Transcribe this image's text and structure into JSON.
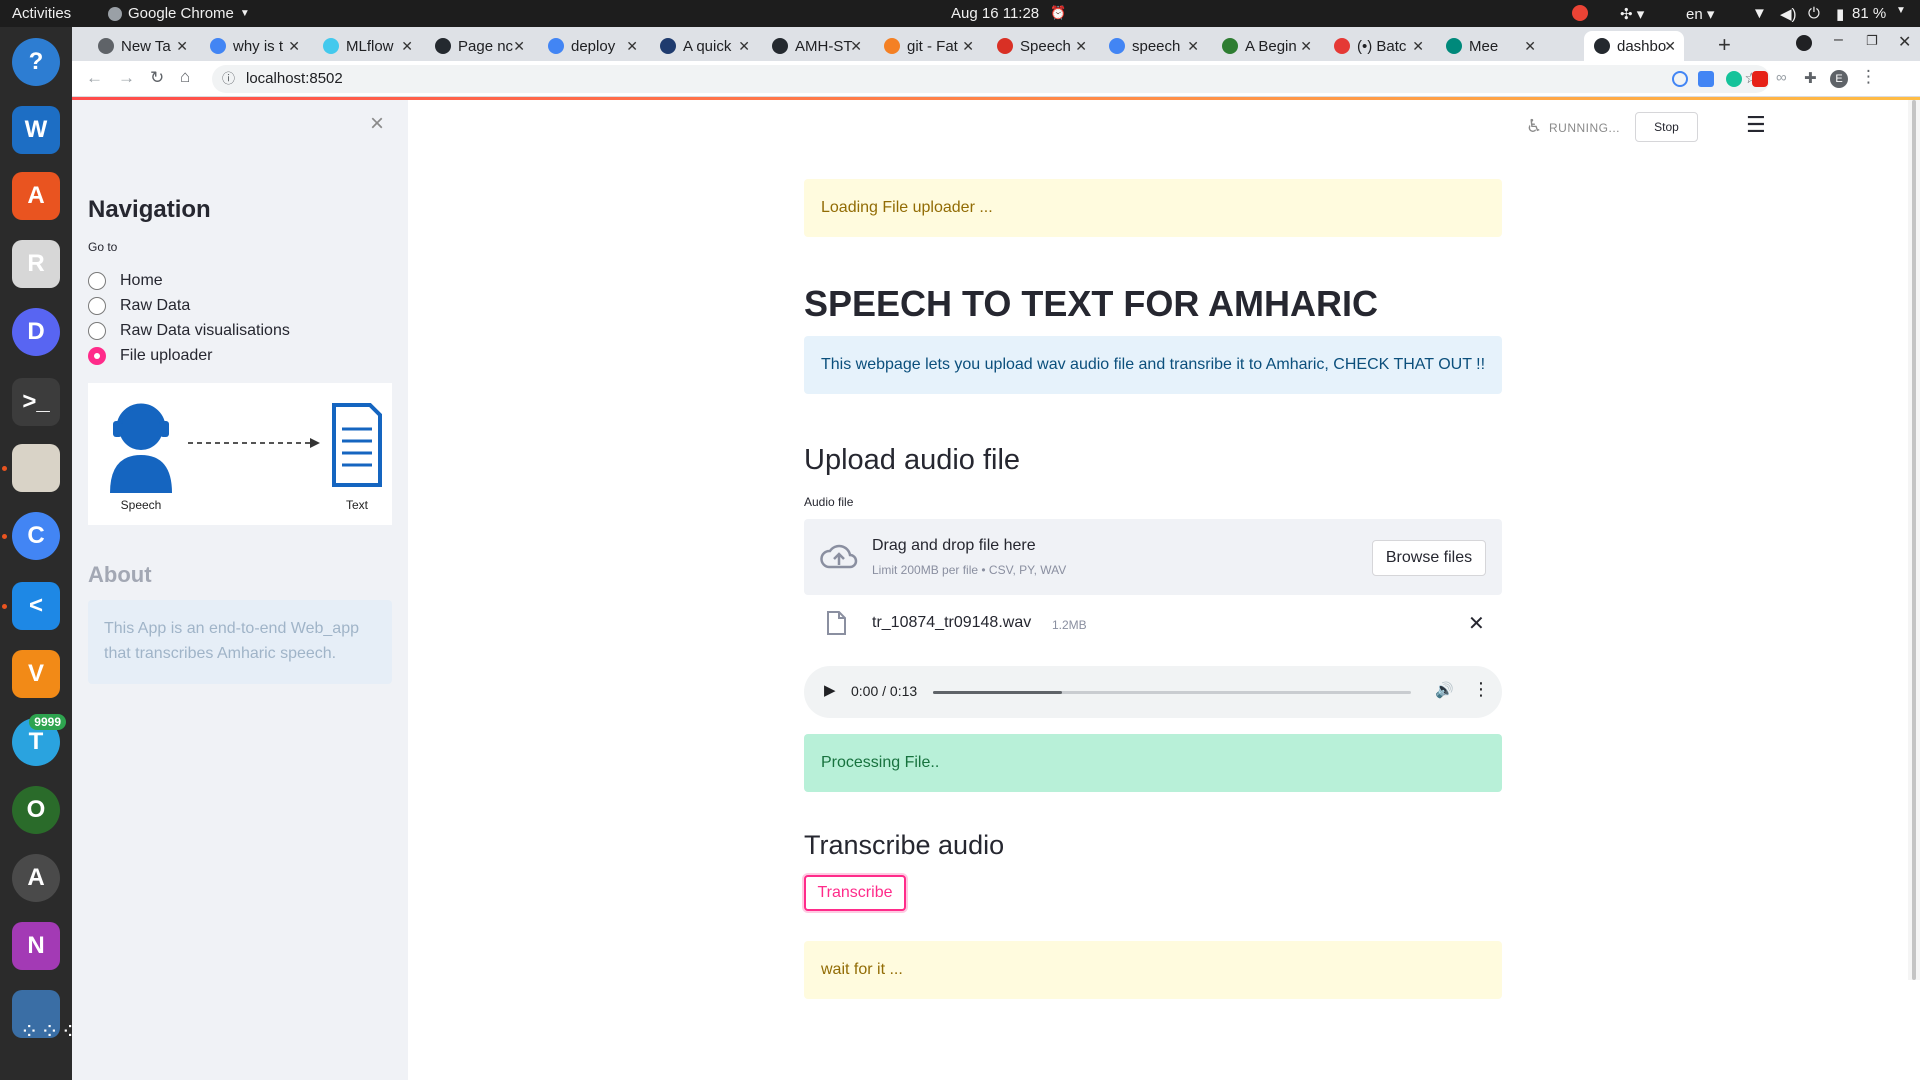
{
  "os": {
    "activities": "Activities",
    "app_name": "Google Chrome",
    "datetime": "Aug 16  11:28",
    "lang": "en",
    "battery": "81 %",
    "dock": [
      {
        "name": "help",
        "color": "#2d7dd2",
        "glyph": "?"
      },
      {
        "name": "writer",
        "color": "#1d6ec4",
        "glyph": "W"
      },
      {
        "name": "software",
        "color": "#e95420",
        "glyph": "A"
      },
      {
        "name": "reader",
        "color": "#d7d7d7",
        "glyph": "R"
      },
      {
        "name": "discord",
        "color": "#5865f2",
        "glyph": "D"
      },
      {
        "name": "terminal",
        "color": "#3c3c3c",
        "glyph": ">_"
      },
      {
        "name": "files",
        "color": "#d9d3c7",
        "glyph": ""
      },
      {
        "name": "chrome",
        "color": "#4285f4",
        "glyph": "C"
      },
      {
        "name": "vscode",
        "color": "#1e88e5",
        "glyph": "<"
      },
      {
        "name": "vlc",
        "color": "#f28a17",
        "glyph": "V"
      },
      {
        "name": "telegram",
        "color": "#2aa3df",
        "glyph": "T",
        "badge": "9999"
      },
      {
        "name": "camera",
        "color": "#2a6b2a",
        "glyph": "O"
      },
      {
        "name": "updater",
        "color": "#4a4a4a",
        "glyph": "A"
      },
      {
        "name": "onenote",
        "color": "#a33ab5",
        "glyph": "N"
      },
      {
        "name": "drive",
        "color": "#3a6ea5",
        "glyph": ""
      }
    ]
  },
  "browser": {
    "tabs": [
      {
        "label": "New Ta",
        "fav": "#5f6368"
      },
      {
        "label": "why is t",
        "fav": "#4285f4"
      },
      {
        "label": "MLflow",
        "fav": "#43c9ed"
      },
      {
        "label": "Page nc",
        "fav": "#24292f"
      },
      {
        "label": "deploy",
        "fav": "#4285f4"
      },
      {
        "label": "A quick",
        "fav": "#1f3b6e"
      },
      {
        "label": "AMH-ST",
        "fav": "#24292f"
      },
      {
        "label": "git - Fat",
        "fav": "#f48024"
      },
      {
        "label": "Speech",
        "fav": "#d93025"
      },
      {
        "label": "speech",
        "fav": "#4285f4"
      },
      {
        "label": "A Begin",
        "fav": "#2e7d32"
      },
      {
        "label": "(•) Batc",
        "fav": "#e53935"
      },
      {
        "label": "Mee",
        "fav": "#00897b"
      },
      {
        "label": "dashbo",
        "fav": "#24292f",
        "active": true
      }
    ],
    "url": "localhost:8502"
  },
  "app": {
    "status": "RUNNING...",
    "stop": "Stop",
    "sidebar": {
      "close_glyph": "×",
      "title": "Navigation",
      "goto": "Go to",
      "options": [
        "Home",
        "Raw Data",
        "Raw Data visualisations",
        "File uploader"
      ],
      "selected": 3,
      "diagram": {
        "left_caption": "Speech",
        "right_caption": "Text"
      },
      "about_title": "About",
      "about_text": "This App is an end-to-end Web_app that transcribes Amharic speech."
    },
    "main": {
      "loading": "Loading File uploader ...",
      "title": "SPEECH TO TEXT FOR AMHARIC",
      "info": "This webpage lets you upload wav audio file and transribe it to Amharic, CHECK THAT OUT !!",
      "upload_header": "Upload audio file",
      "uploader": {
        "label": "Audio file",
        "drag_text": "Drag and drop file here",
        "limit": "Limit 200MB per file • CSV, PY, WAV",
        "browse": "Browse files",
        "file_name": "tr_10874_tr09148.wav",
        "file_size": "1.2MB"
      },
      "audio": {
        "time": "0:00 / 0:13",
        "progress": 0.27
      },
      "processing": "Processing File..",
      "transcribe_header": "Transcribe audio",
      "transcribe_btn": "Transcribe",
      "wait": "wait for it ..."
    }
  },
  "colors": {
    "accent": "#ff2b8a",
    "warning_bg": "#fffbde",
    "warning_text": "#926c05",
    "info_bg": "#e6f2fb",
    "info_text": "#0b4f7c",
    "success_bg": "#b8f0d8",
    "success_text": "#17723e"
  }
}
